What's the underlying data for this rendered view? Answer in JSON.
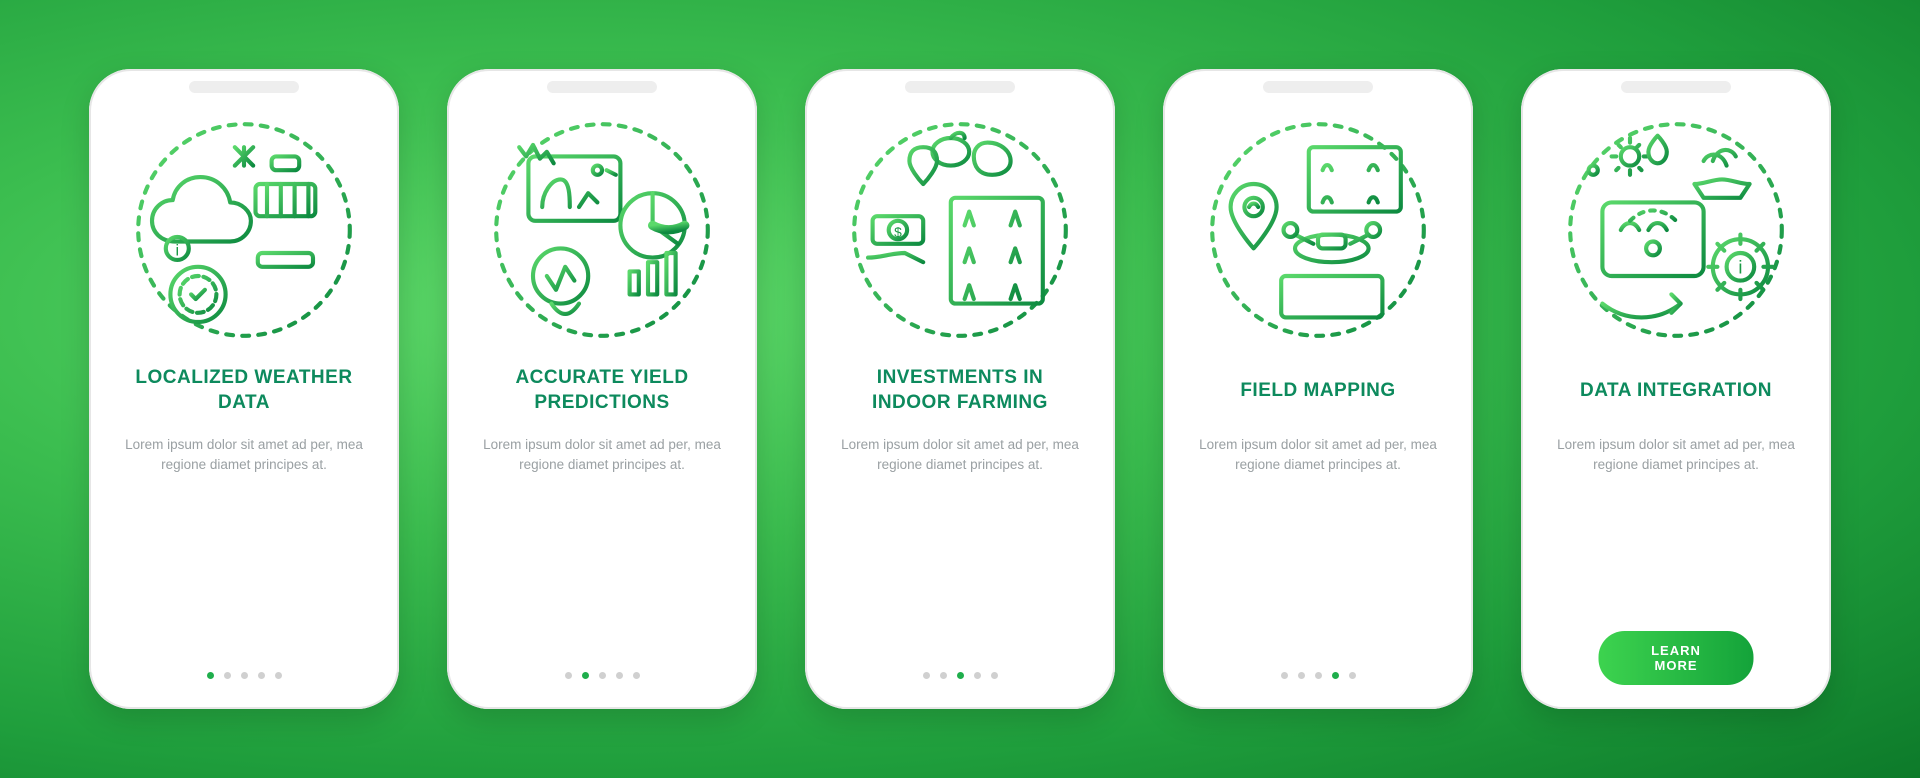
{
  "screens": [
    {
      "title": "LOCALIZED WEATHER DATA",
      "desc": "Lorem ipsum dolor sit amet ad per, mea regione diamet principes at.",
      "icon": "weather-station-icon",
      "activeDot": 0,
      "hasCta": false
    },
    {
      "title": "ACCURATE YIELD PREDICTIONS",
      "desc": "Lorem ipsum dolor sit amet ad per, mea regione diamet principes at.",
      "icon": "yield-chart-icon",
      "activeDot": 1,
      "hasCta": false
    },
    {
      "title": "INVESTMENTS IN INDOOR FARMING",
      "desc": "Lorem ipsum dolor sit amet ad per, mea regione diamet principes at.",
      "icon": "indoor-farming-icon",
      "activeDot": 2,
      "hasCta": false
    },
    {
      "title": "FIELD MAPPING",
      "desc": "Lorem ipsum dolor sit amet ad per, mea regione diamet principes at.",
      "icon": "field-mapping-icon",
      "activeDot": 3,
      "hasCta": false
    },
    {
      "title": "DATA INTEGRATION",
      "desc": "Lorem ipsum dolor sit amet ad per, mea regione diamet principes at.",
      "icon": "data-integration-icon",
      "activeDot": 4,
      "hasCta": true
    }
  ],
  "ctaLabel": "LEARN MORE",
  "dotCount": 5,
  "colors": {
    "primary": "#1fae4c",
    "titleColor": "#0d8a5d",
    "ctaGradientStart": "#3dd34f",
    "ctaGradientEnd": "#14a33a"
  }
}
